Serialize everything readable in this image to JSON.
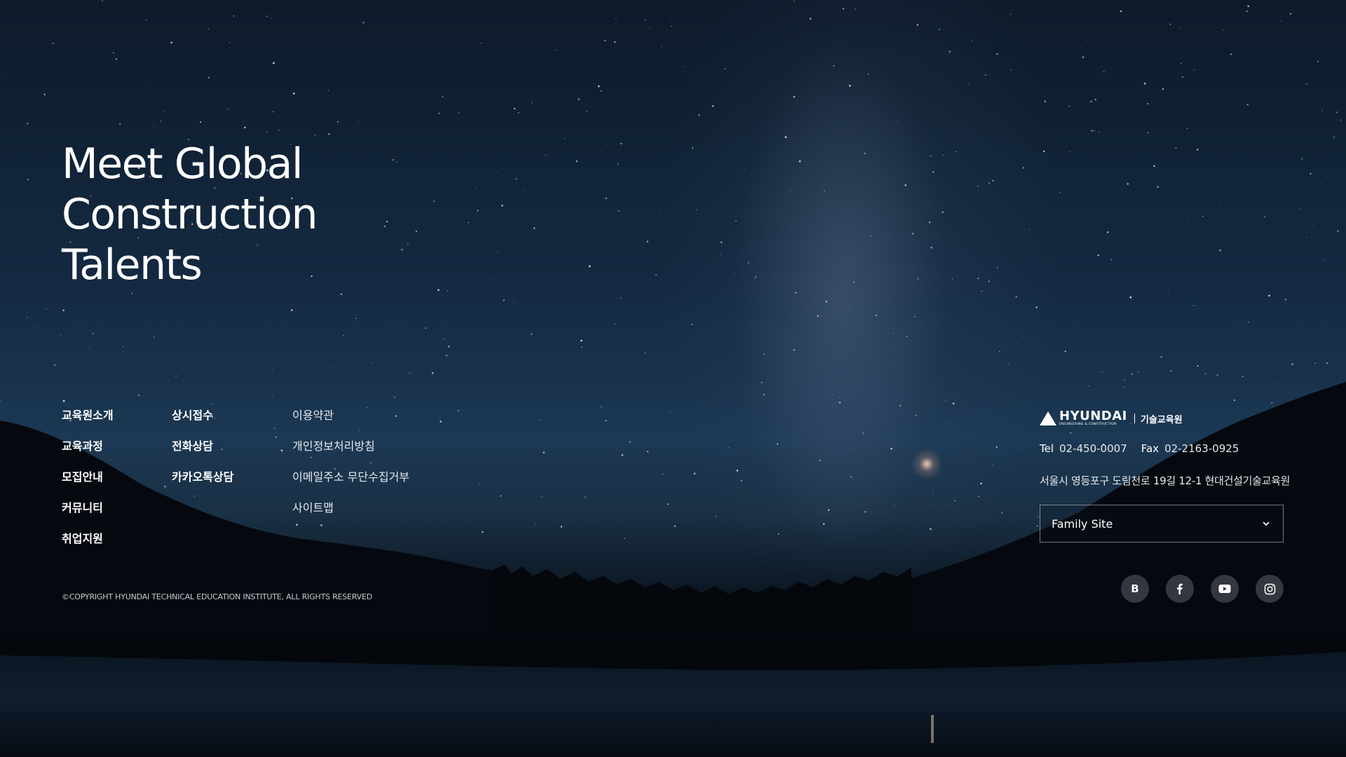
{
  "hero": {
    "lines": [
      "Meet Global",
      "Construction",
      "Talents"
    ]
  },
  "nav": {
    "col1": [
      "교육원소개",
      "교육과정",
      "모집안내",
      "커뮤니티",
      "취업지원"
    ],
    "col2": [
      "상시접수",
      "전화상담",
      "카카오톡상담"
    ],
    "col3": [
      "이용약관",
      "개인정보처리방침",
      "이메일주소 무단수집거부",
      "사이트맵"
    ]
  },
  "copyright": "©COPYRIGHT HYUNDAI TECHNICAL EDUCATION INSTITUTE, ALL RIGHTS RESERVED",
  "brand": {
    "wordmark": "HYUNDAI",
    "tagline": "ENGINEERING & CONSTRUCTION",
    "sub": "기술교육원"
  },
  "contact": {
    "tel_label": "Tel",
    "tel": "02-450-0007",
    "fax_label": "Fax",
    "fax": "02-2163-0925",
    "address": "서울시 영등포구 도림천로 19길 12-1 현대건설기술교육원"
  },
  "family_site": {
    "label": "Family Site"
  },
  "social": {
    "blog_letter": "B",
    "icons": [
      "blog-icon",
      "facebook-icon",
      "youtube-icon",
      "instagram-icon"
    ]
  },
  "colors": {
    "text": "#ffffff",
    "social_bg": "#3c4048"
  }
}
